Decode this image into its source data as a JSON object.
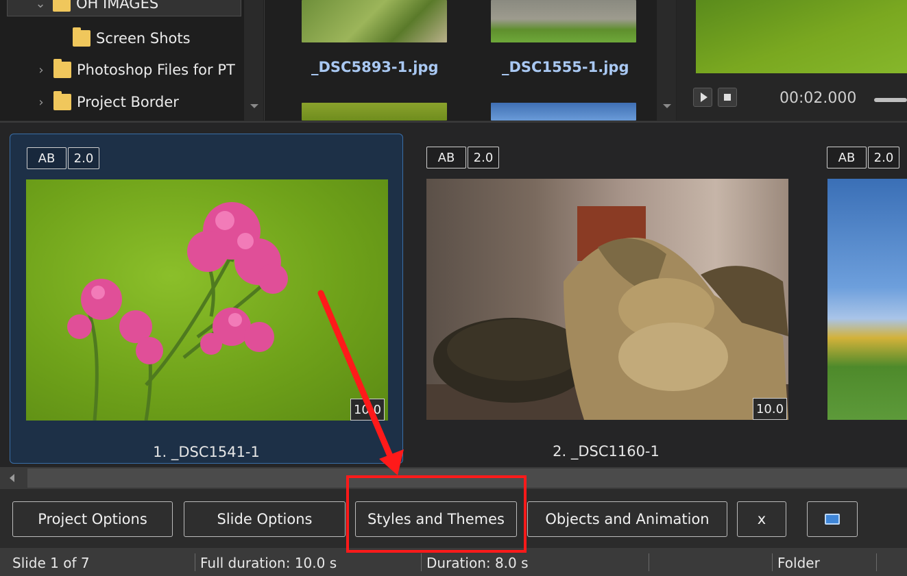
{
  "folder_tree": {
    "items": [
      {
        "label": "OH IMAGES",
        "expanded": true
      },
      {
        "label": "Screen Shots"
      },
      {
        "label": "Photoshop Files for PT"
      },
      {
        "label": "Project Border"
      }
    ]
  },
  "file_browser": {
    "files": [
      {
        "name": "_DSC5893-1.jpg"
      },
      {
        "name": "_DSC1555-1.jpg"
      }
    ]
  },
  "preview": {
    "timecode": "00:02.000"
  },
  "slides": [
    {
      "index_label": "1. _DSC1541-1",
      "ab": "AB",
      "transition": "2.0",
      "duration": "10.0",
      "selected": true
    },
    {
      "index_label": "2. _DSC1160-1",
      "ab": "AB",
      "transition": "2.0",
      "duration": "10.0",
      "selected": false
    },
    {
      "ab": "AB",
      "transition": "2.0"
    }
  ],
  "toolbar": {
    "project_options": "Project Options",
    "slide_options": "Slide Options",
    "styles_and_themes": "Styles and Themes",
    "objects_and_animation": "Objects and Animation",
    "x_label": "x"
  },
  "status": {
    "slide": "Slide 1 of 7",
    "full_duration": "Full duration: 10.0 s",
    "duration": "Duration: 8.0 s",
    "folder": "Folder"
  },
  "annotation": {
    "highlight_color": "#ff1a1a"
  }
}
